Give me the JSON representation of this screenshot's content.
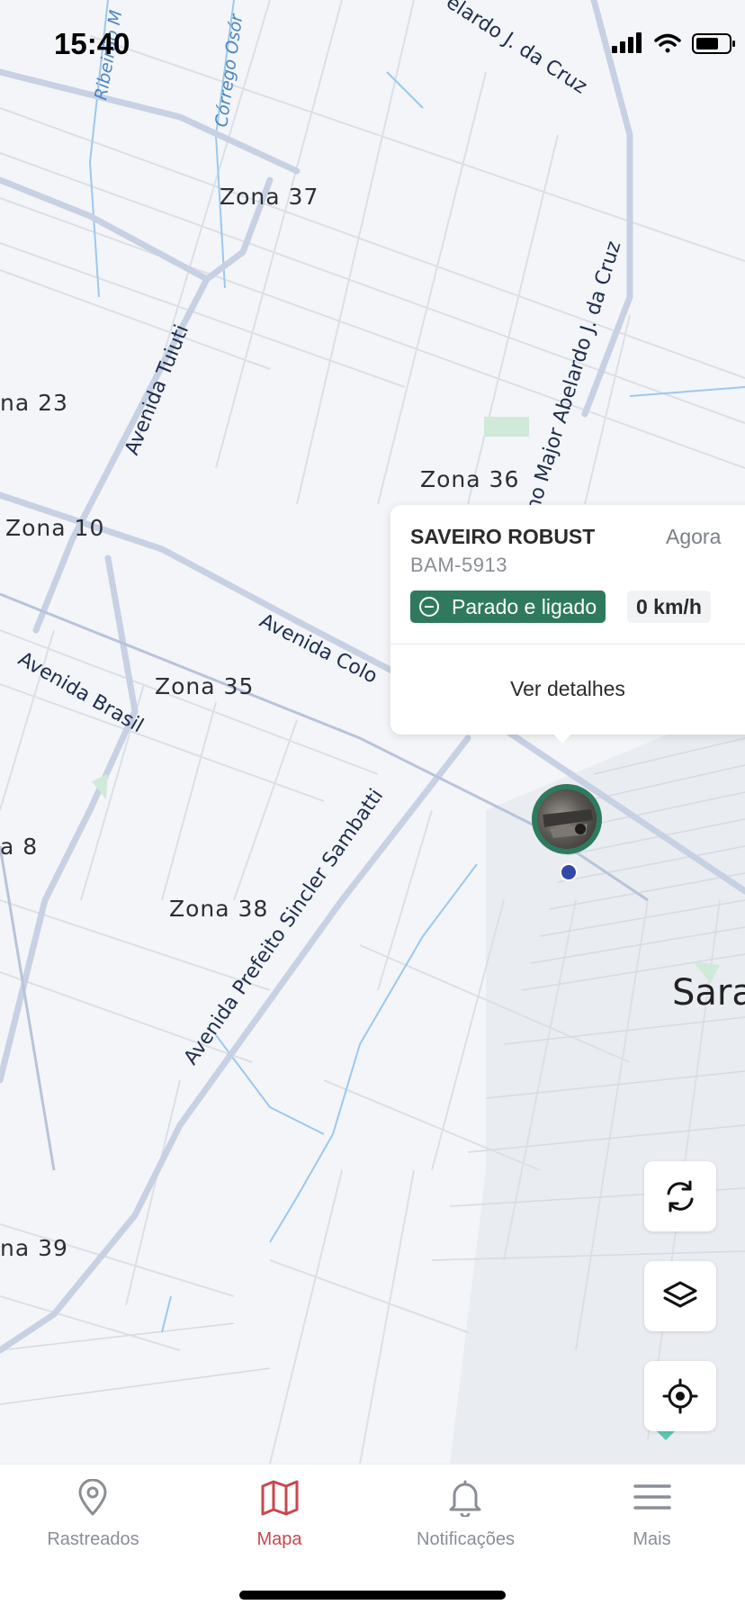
{
  "status_bar": {
    "time": "15:40"
  },
  "map": {
    "zone_labels": [
      "Zona 37",
      "Zona 36",
      "Zona 10",
      "na 23",
      "Zona 35",
      "a 8",
      "Zona 38",
      "na 39"
    ],
    "street_labels": [
      "Avenida Tuiuti",
      "Avenida Colo",
      "Avenida Brasil",
      "Avenida Prefeito Sincler Sambatti",
      "no Major Abelardo J. da Cruz",
      "elardo J. da Cruz"
    ],
    "water_labels": [
      "Ribeirão M",
      "Córrego Osór"
    ],
    "city_label": "Sara"
  },
  "popup": {
    "vehicle_name": "SAVEIRO ROBUST",
    "time": "Agora",
    "plate": "BAM-5913",
    "status": "Parado e ligado",
    "speed": "0 km/h",
    "details_label": "Ver detalhes",
    "status_color": "#2f7a5e"
  },
  "controls": {
    "icons": [
      "refresh-icon",
      "layers-icon",
      "locate-icon"
    ]
  },
  "bottom_nav": {
    "items": [
      {
        "label": "Rastreados",
        "icon": "map-pin-icon",
        "active": false
      },
      {
        "label": "Mapa",
        "icon": "map-icon",
        "active": true
      },
      {
        "label": "Notificações",
        "icon": "bell-icon",
        "active": false
      },
      {
        "label": "Mais",
        "icon": "menu-icon",
        "active": false
      }
    ],
    "active_color": "#c8484e"
  }
}
